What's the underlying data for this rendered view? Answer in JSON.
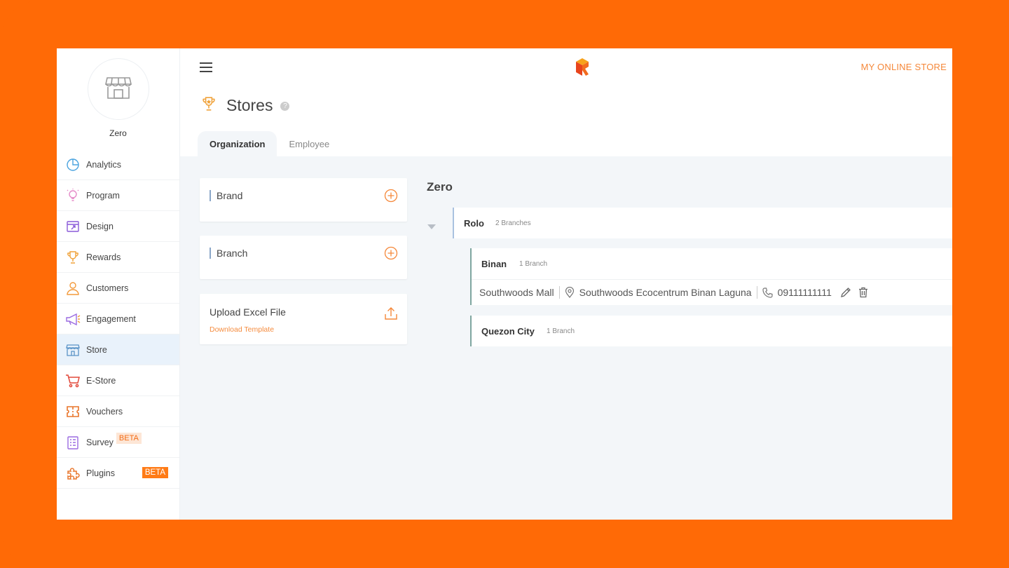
{
  "sidebar": {
    "user_name": "Zero",
    "items": [
      {
        "label": "Analytics",
        "icon": "analytics-icon"
      },
      {
        "label": "Program",
        "icon": "lightbulb-icon"
      },
      {
        "label": "Design",
        "icon": "design-icon"
      },
      {
        "label": "Rewards",
        "icon": "trophy-icon"
      },
      {
        "label": "Customers",
        "icon": "user-icon"
      },
      {
        "label": "Engagement",
        "icon": "megaphone-icon"
      },
      {
        "label": "Store",
        "icon": "store-icon",
        "active": true
      },
      {
        "label": "E-Store",
        "icon": "cart-icon"
      },
      {
        "label": "Vouchers",
        "icon": "voucher-icon"
      },
      {
        "label": "Survey",
        "icon": "clipboard-icon",
        "badge": "BETA"
      },
      {
        "label": "Plugins",
        "icon": "puzzle-icon",
        "badge": "BETA"
      }
    ]
  },
  "topbar": {
    "store_link": "MY ONLINE STORE"
  },
  "page": {
    "title": "Stores",
    "help": "?",
    "tabs": [
      {
        "label": "Organization",
        "active": true
      },
      {
        "label": "Employee",
        "active": false
      }
    ]
  },
  "cards": {
    "brand_label": "Brand",
    "branch_label": "Branch",
    "upload_title": "Upload Excel File",
    "upload_link": "Download Template"
  },
  "tree": {
    "organization": "Zero",
    "brand": {
      "name": "Rolo",
      "count": "2 Branches"
    },
    "branches": [
      {
        "name": "Binan",
        "count": "1 Branch",
        "store": {
          "name": "Southwoods Mall",
          "address": "Southwoods Ecocentrum Binan Laguna",
          "phone": "09111111111"
        }
      },
      {
        "name": "Quezon City",
        "count": "1 Branch"
      }
    ]
  },
  "colors": {
    "accent": "#ff6a06",
    "link": "#f5883a",
    "active_nav": "#e9f2fb"
  }
}
